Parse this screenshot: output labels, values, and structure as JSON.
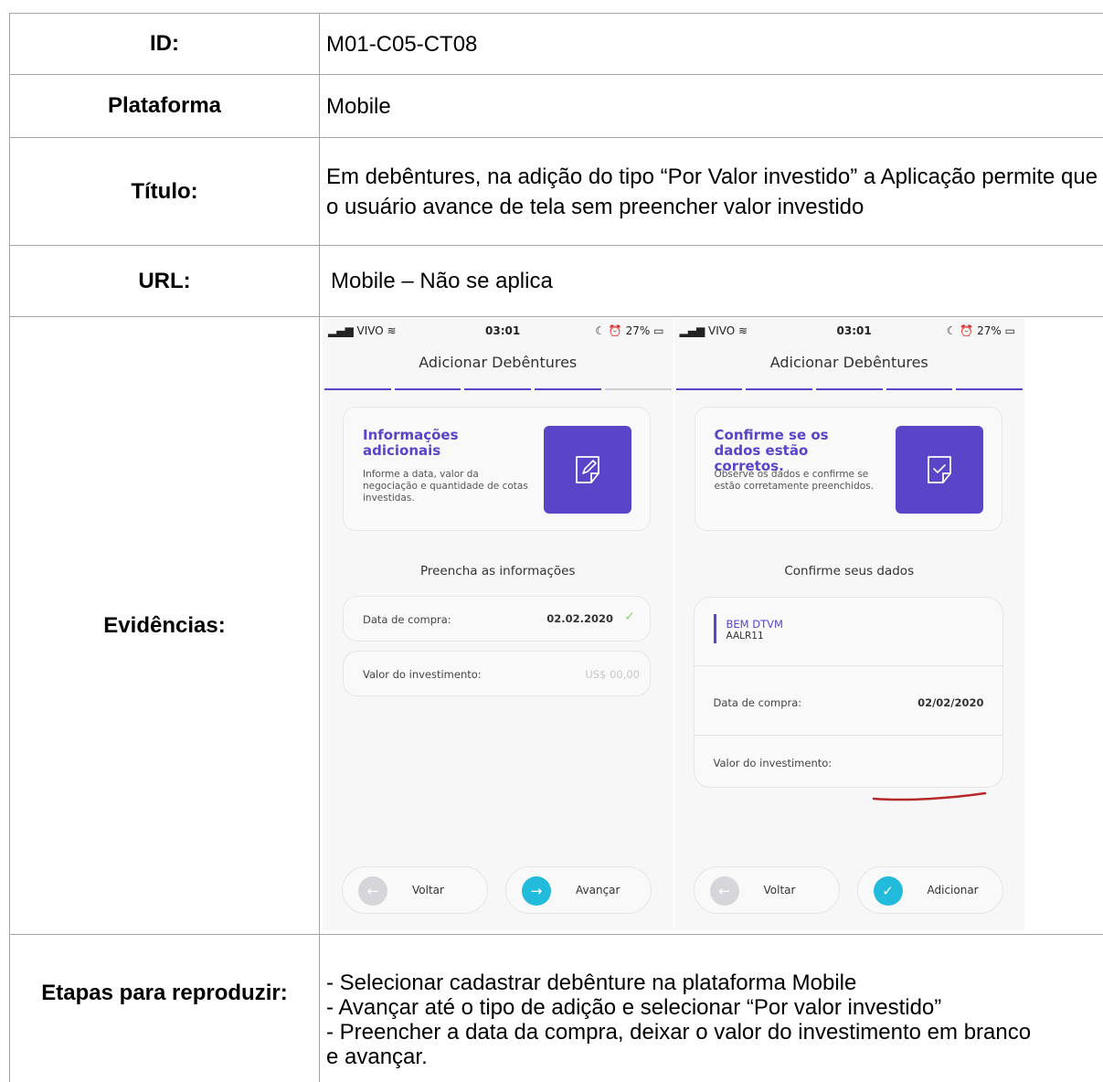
{
  "rows": {
    "id": {
      "label": "ID:",
      "value": "M01-C05-CT08"
    },
    "platform": {
      "label": "Plataforma",
      "value": "Mobile"
    },
    "title": {
      "label": "Título:",
      "value": "Em debêntures, na adição do tipo “Por Valor investido” a Aplicação permite que o usuário avance de tela sem preencher valor investido"
    },
    "url": {
      "label": "URL:",
      "value": "Mobile – Não se aplica"
    },
    "evidence": {
      "label": "Evidências:"
    },
    "steps": {
      "label": "Etapas para reproduzir:",
      "items": [
        "- Selecionar cadastrar debênture na plataforma Mobile",
        "- Avançar até o tipo de adição e selecionar “Por valor investido”",
        "- Preencher a data da compra, deixar o valor do investimento em branco",
        "e avançar."
      ]
    }
  },
  "phone1": {
    "carrier": "VIVO",
    "time": "03:01",
    "battery": "27%",
    "header": "Adicionar Debêntures",
    "progress_done": 4,
    "progress_total": 5,
    "card_title": "Informações adicionais",
    "card_text": "Informe a data, valor da negociação e quantidade de cotas investidas.",
    "section_title": "Preencha as informações",
    "date_label": "Data de compra:",
    "date_value": "02.02.2020",
    "invest_label": "Valor do investimento:",
    "invest_placeholder": "US$ 00,00",
    "back_label": "Voltar",
    "next_label": "Avançar",
    "icon": "edit-note-icon"
  },
  "phone2": {
    "carrier": "VIVO",
    "time": "03:01",
    "battery": "27%",
    "header": "Adicionar Debêntures",
    "progress_done": 5,
    "progress_total": 5,
    "card_title": "Confirme se os dados estão corretos.",
    "card_text": "Observe os dados e confirme se estão corretamente preenchidos.",
    "section_title": "Confirme seus dados",
    "entity_name": "BEM DTVM",
    "entity_ticker": "AALR11",
    "date_label": "Data de compra:",
    "date_value": "02/02/2020",
    "invest_label": "Valor do investimento:",
    "back_label": "Voltar",
    "add_label": "Adicionar",
    "icon": "check-note-icon"
  },
  "colors": {
    "accent": "#5a44c8",
    "cyan": "#22bbdc",
    "annotation_red": "#b42a2a",
    "check_green": "#8ed07a"
  }
}
